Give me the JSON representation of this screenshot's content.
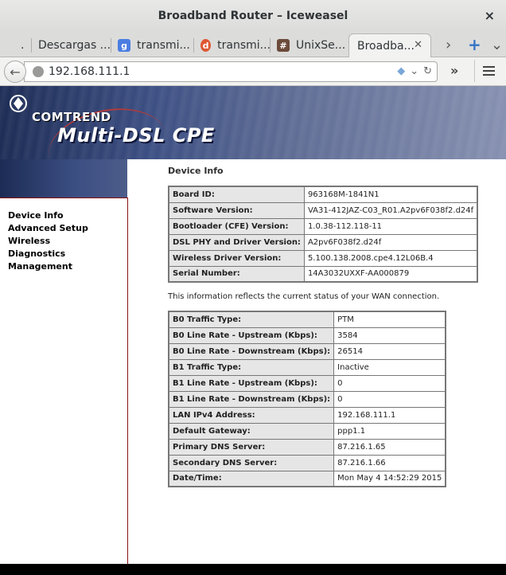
{
  "window": {
    "title": "Broadband Router – Iceweasel",
    "close": "×"
  },
  "tabs": [
    {
      "label": ".",
      "icon": ""
    },
    {
      "label": "Descargas ...",
      "icon": ""
    },
    {
      "label": "transmi...",
      "icon": "google-icon"
    },
    {
      "label": "transmi...",
      "icon": "duckduckgo-icon"
    },
    {
      "label": "UnixSe...",
      "icon": "unix-se-icon"
    },
    {
      "label": "Broadba...",
      "icon": "",
      "active": true
    }
  ],
  "tabbar": {
    "left_arrow": "‹",
    "right_arrow": "›",
    "new_tab": "+"
  },
  "navbar": {
    "url": "192.168.111.1",
    "back": "←",
    "overflow": "»"
  },
  "banner": {
    "brand": "COMTREND",
    "product": "Multi-DSL CPE"
  },
  "sidebar": {
    "items": [
      "Device Info",
      "Advanced Setup",
      "Wireless",
      "Diagnostics",
      "Management"
    ]
  },
  "content": {
    "heading": "Device Info",
    "device_table": [
      {
        "key": "Board ID:",
        "value": "963168M-1841N1"
      },
      {
        "key": "Software Version:",
        "value": "VA31-412JAZ-C03_R01.A2pv6F038f2.d24f"
      },
      {
        "key": "Bootloader (CFE) Version:",
        "value": "1.0.38-112.118-11"
      },
      {
        "key": "DSL PHY and Driver Version:",
        "value": "A2pv6F038f2.d24f"
      },
      {
        "key": "Wireless Driver Version:",
        "value": "5.100.138.2008.cpe4.12L06B.4"
      },
      {
        "key": "Serial Number:",
        "value": "14A3032UXXF-AA000879"
      }
    ],
    "note": "This information reflects the current status of your WAN connection.",
    "wan_table": [
      {
        "key": "B0 Traffic Type:",
        "value": "PTM"
      },
      {
        "key": "B0 Line Rate - Upstream (Kbps):",
        "value": "3584"
      },
      {
        "key": "B0 Line Rate - Downstream (Kbps):",
        "value": "26514"
      },
      {
        "key": "B1 Traffic Type:",
        "value": "Inactive"
      },
      {
        "key": "B1 Line Rate - Upstream (Kbps):",
        "value": "0"
      },
      {
        "key": "B1 Line Rate - Downstream (Kbps):",
        "value": "0"
      },
      {
        "key": "LAN IPv4 Address:",
        "value": "192.168.111.1"
      },
      {
        "key": "Default Gateway:",
        "value": "ppp1.1"
      },
      {
        "key": "Primary DNS Server:",
        "value": "87.216.1.65"
      },
      {
        "key": "Secondary DNS Server:",
        "value": "87.216.1.66"
      },
      {
        "key": "Date/Time:",
        "value": "Mon May 4 14:52:29 2015"
      }
    ]
  }
}
